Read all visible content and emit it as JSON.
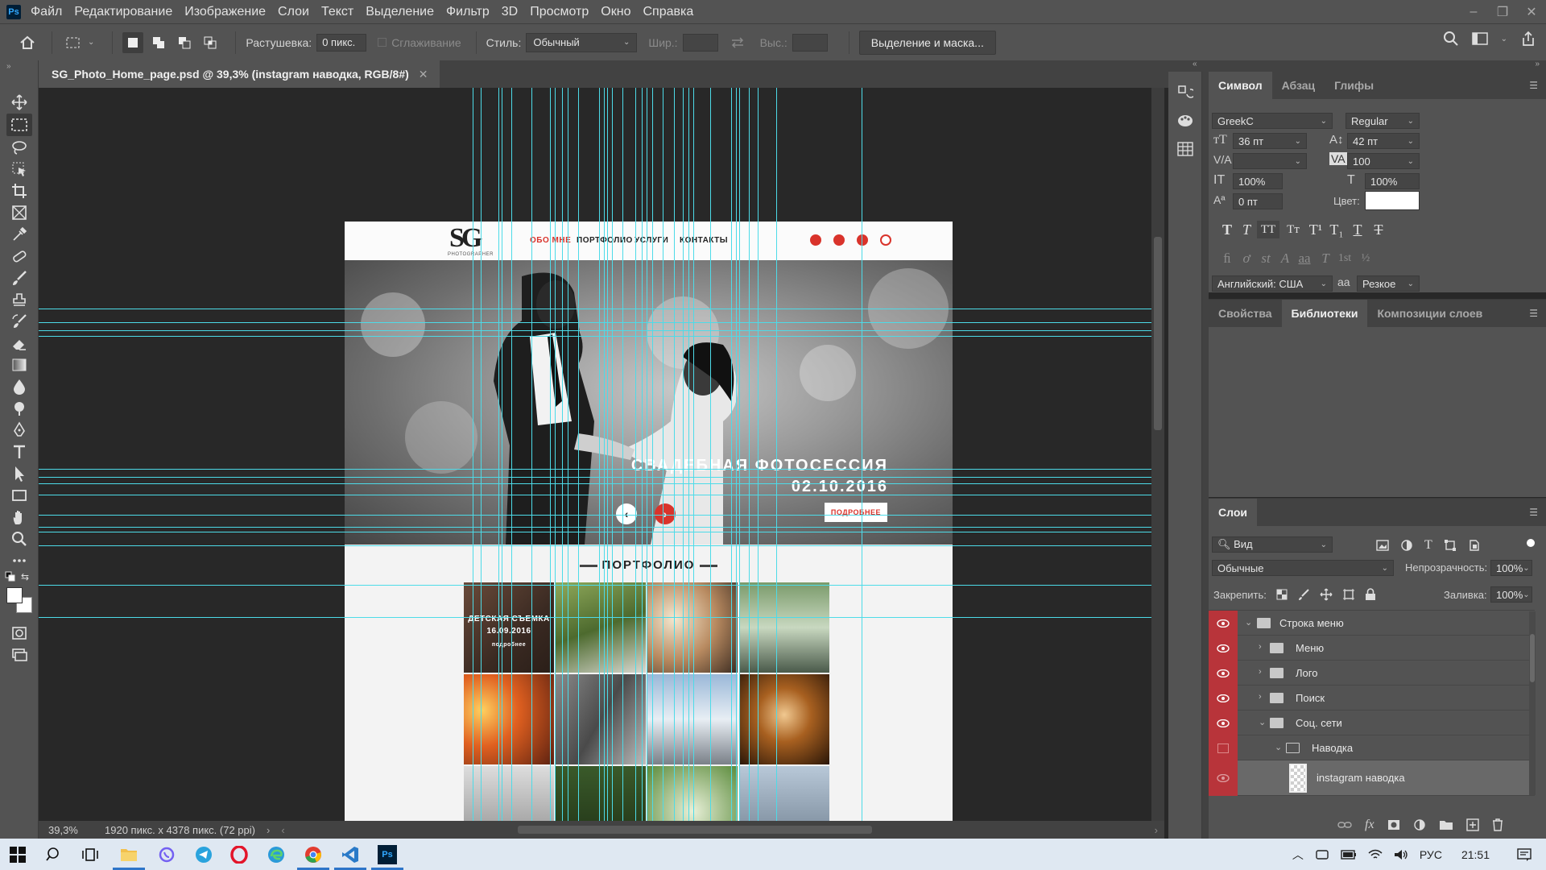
{
  "menubar": {
    "logo": "Ps",
    "items": [
      "Файл",
      "Редактирование",
      "Изображение",
      "Слои",
      "Текст",
      "Выделение",
      "Фильтр",
      "3D",
      "Просмотр",
      "Окно",
      "Справка"
    ]
  },
  "options": {
    "feather_label": "Растушевка:",
    "feather_value": "0 пикс.",
    "antialias_label": "Сглаживание",
    "style_label": "Стиль:",
    "style_value": "Обычный",
    "width_label": "Шир.:",
    "height_label": "Выс.:",
    "select_mask_button": "Выделение и маска..."
  },
  "document": {
    "tab_title": "SG_Photo_Home_page.psd @ 39,3% (instagram наводка, RGB/8#)",
    "zoom": "39,3%",
    "doc_info": "1920 пикс. x 4378 пикс. (72 ppi)",
    "site": {
      "nav": [
        "ОБО МНЕ",
        "ПОРТФОЛИО",
        "УСЛУГИ",
        "КОНТАКТЫ"
      ],
      "hero_title": "СВАДЕБНАЯ ФОТОСЕССИЯ",
      "hero_date": "02.10.2016",
      "hero_button": "ПОДРОБНЕЕ",
      "portfolio_heading": "ПОРТФОЛИО",
      "tile_caption_title": "ДЕТСКАЯ СЪЕМКА",
      "tile_caption_date": "16.09.2016",
      "tile_caption_more": "подробнее"
    }
  },
  "character_panel": {
    "tabs": [
      "Символ",
      "Абзац",
      "Глифы"
    ],
    "font_family": "GreekC",
    "font_style": "Regular",
    "font_size": "36 пт",
    "leading": "42 пт",
    "kerning": "",
    "tracking": "100",
    "vertical_scale": "100%",
    "horizontal_scale": "100%",
    "baseline_shift": "0 пт",
    "color_label": "Цвет:",
    "language": "Английский: США",
    "antialias_icon": "aa",
    "antialias": "Резкое"
  },
  "libraries_panel": {
    "tabs": [
      "Свойства",
      "Библиотеки",
      "Композиции слоев"
    ]
  },
  "layers_panel": {
    "tab": "Слои",
    "filter": "Вид",
    "blend_mode": "Обычные",
    "opacity_label": "Непрозрачность:",
    "opacity": "100%",
    "lock_label": "Закрепить:",
    "fill_label": "Заливка:",
    "fill": "100%",
    "layers": [
      {
        "name": "Строка меню",
        "indent": 0,
        "type": "folder",
        "open": true,
        "visible": true
      },
      {
        "name": "Меню",
        "indent": 1,
        "type": "folder",
        "open": false,
        "visible": true
      },
      {
        "name": "Лого",
        "indent": 1,
        "type": "folder",
        "open": false,
        "visible": true
      },
      {
        "name": "Поиск",
        "indent": 1,
        "type": "folder",
        "open": false,
        "visible": true
      },
      {
        "name": "Соц. сети",
        "indent": 1,
        "type": "folder",
        "open": true,
        "visible": true
      },
      {
        "name": "Наводка",
        "indent": 2,
        "type": "folder",
        "open": true,
        "visible": false
      },
      {
        "name": "instagram наводка",
        "indent": 3,
        "type": "layer",
        "visible": true,
        "selected": true
      }
    ]
  },
  "taskbar": {
    "lang": "РУС",
    "time": "21:51"
  },
  "colors": {
    "accent_red": "#d9332b",
    "guide_cyan": "#4ddbe8",
    "ui_gray": "#535353",
    "canvas_bg": "#282828"
  }
}
